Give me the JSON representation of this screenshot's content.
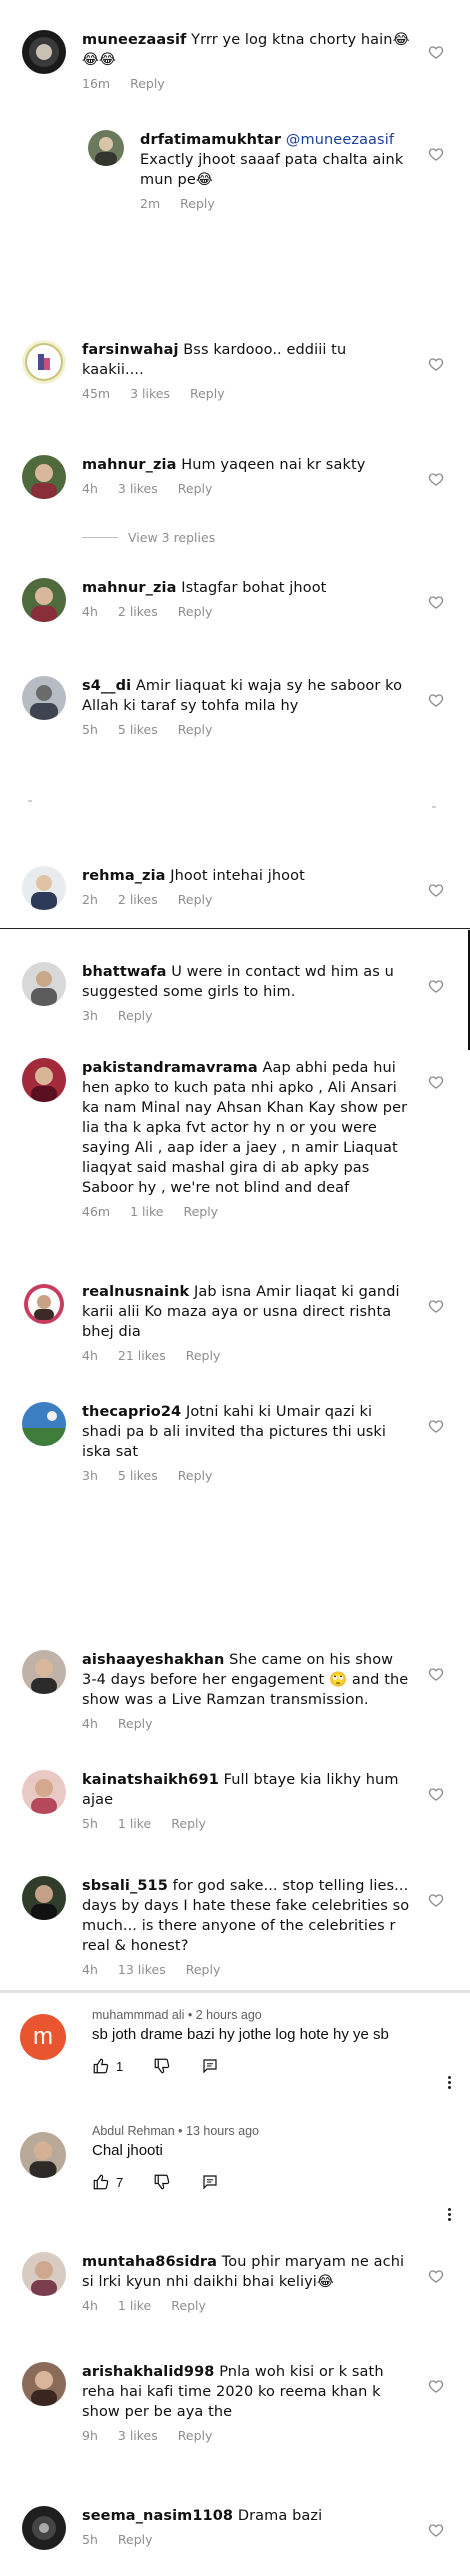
{
  "comments": [
    {
      "id": "c1",
      "user": "muneezaasif",
      "text": "Yrrr ye log ktna chorty hain😂😂😂",
      "time": "16m",
      "reply": "Reply",
      "likes": ""
    },
    {
      "id": "c2",
      "user": "drfatimamukhtar",
      "mention": "@muneezaasif",
      "text": "Exactly jhoot saaaf pata chalta aink mun pe😂",
      "time": "2m",
      "reply": "Reply",
      "likes": ""
    },
    {
      "id": "c3",
      "user": "farsinwahaj",
      "text": "Bss kardooo.. eddiii tu kaakii....",
      "time": "45m",
      "reply": "Reply",
      "likes": "3 likes"
    },
    {
      "id": "c4",
      "user": "mahnur_zia",
      "text": "Hum yaqeen nai kr sakty",
      "time": "4h",
      "reply": "Reply",
      "likes": "3 likes",
      "view_replies": "View 3 replies"
    },
    {
      "id": "c5",
      "user": "mahnur_zia",
      "text": "Istagfar bohat jhoot",
      "time": "4h",
      "reply": "Reply",
      "likes": "2 likes"
    },
    {
      "id": "c6",
      "user": "s4__di",
      "text": "Amir liaquat ki waja sy he saboor ko Allah ki taraf sy tohfa mila hy",
      "time": "5h",
      "reply": "Reply",
      "likes": "5 likes"
    },
    {
      "id": "c7",
      "user": "rehma_zia",
      "text": "Jhoot intehai jhoot",
      "time": "2h",
      "reply": "Reply",
      "likes": "2 likes"
    },
    {
      "id": "c8",
      "user": "bhattwafa",
      "text": "U were in contact wd him as u suggested some girls to him.",
      "time": "3h",
      "reply": "Reply",
      "likes": ""
    },
    {
      "id": "c9",
      "user": "pakistandramavrama",
      "text": "Aap abhi peda hui hen apko to kuch pata nhi apko , Ali Ansari ka nam Minal nay Ahsan Khan Kay show per lia tha k apka fvt actor hy n or you were saying Ali , aap ider a jaey , n amir Liaquat liaqyat said mashal gira di ab apky pas Saboor hy , we're not blind and deaf",
      "time": "46m",
      "reply": "Reply",
      "likes": "1 like"
    },
    {
      "id": "c10",
      "user": "realnusnaink",
      "text": "Jab isna Amir liaqat ki gandi karii alii Ko maza aya or usna direct rishta bhej dia",
      "time": "4h",
      "reply": "Reply",
      "likes": "21 likes"
    },
    {
      "id": "c11",
      "user": "thecaprio24",
      "text": "Jotni kahi ki Umair qazi ki shadi pa b ali  invited tha pictures thi uski iska sat",
      "time": "3h",
      "reply": "Reply",
      "likes": "5 likes"
    },
    {
      "id": "c12",
      "user": "aishaayeshakhan",
      "text": "She came on his show 3-4 days before her engagement 🙄 and the show was a Live Ramzan transmission.",
      "time": "4h",
      "reply": "Reply",
      "likes": ""
    },
    {
      "id": "c13",
      "user": "kainatshaikh691",
      "text": "Full btaye kia likhy hum ajae",
      "time": "5h",
      "reply": "Reply",
      "likes": "1 like"
    },
    {
      "id": "c14",
      "user": "sbsali_515",
      "text": "for god sake... stop telling lies... days by days I hate these fake celebrities so much... is there anyone of the celebrities r real & honest?",
      "time": "4h",
      "reply": "Reply",
      "likes": "13 likes"
    },
    {
      "id": "c17",
      "user": "muntaha86sidra",
      "text": "Tou phir maryam ne achi si lrki kyun nhi daikhi bhai keliyi😂",
      "time": "4h",
      "reply": "Reply",
      "likes": "1 like"
    },
    {
      "id": "c18",
      "user": "arishakhalid998",
      "text": "Pnla woh kisi or k sath reha hai kafi time 2020 ko reema khan k show per be aya the",
      "time": "9h",
      "reply": "Reply",
      "likes": "3 likes"
    },
    {
      "id": "c19",
      "user": "seema_nasim1108",
      "text": "Drama bazi",
      "time": "5h",
      "reply": "Reply",
      "likes": ""
    }
  ],
  "yt_comments": [
    {
      "id": "y1",
      "author": "muhammmad ali",
      "sep": " • ",
      "time": "2 hours ago",
      "text": "sb joth drame bazi hy jothe log hote hy ye sb",
      "likes": "1",
      "avatar_letter": "m"
    },
    {
      "id": "y2",
      "author": "Abdul Rehman",
      "sep": " • ",
      "time": "13 hours ago",
      "text": "Chal jhooti",
      "likes": "7",
      "avatar_letter": ""
    }
  ],
  "colors": {
    "accent": "#1d3f9c",
    "muted": "#8e8e8e",
    "yt_avatar": "#e8552e"
  },
  "icons": {
    "like": "heart-icon",
    "yt_like": "thumbs-up-icon",
    "yt_dislike": "thumbs-down-icon",
    "yt_reply": "comment-icon",
    "more": "kebab-icon"
  }
}
